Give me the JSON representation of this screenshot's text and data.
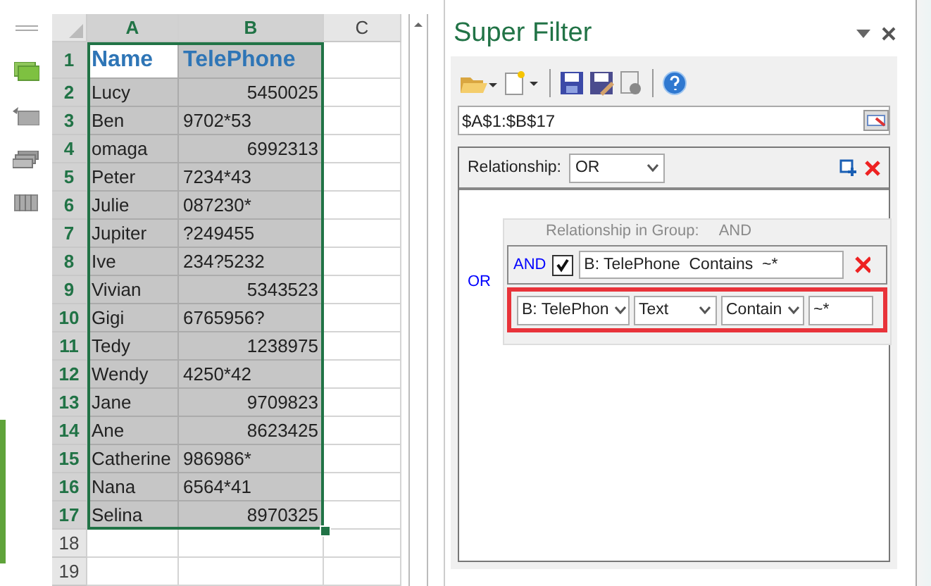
{
  "sheet": {
    "columns": [
      {
        "label": "A",
        "selected": true
      },
      {
        "label": "B",
        "selected": true
      },
      {
        "label": "C",
        "selected": false
      }
    ],
    "rows": [
      {
        "number": "1",
        "selected": true,
        "kind": "header",
        "cells": [
          {
            "text": "Name",
            "active": true
          },
          {
            "text": "TelePhone",
            "active": false
          }
        ]
      },
      {
        "number": "2",
        "selected": true,
        "kind": "data",
        "cells": [
          {
            "text": "Lucy",
            "kind": "text"
          },
          {
            "text": "5450025",
            "kind": "number"
          }
        ]
      },
      {
        "number": "3",
        "selected": true,
        "kind": "data",
        "cells": [
          {
            "text": "Ben",
            "kind": "text"
          },
          {
            "text": "9702*53",
            "kind": "text"
          }
        ]
      },
      {
        "number": "4",
        "selected": true,
        "kind": "data",
        "cells": [
          {
            "text": "omaga",
            "kind": "text"
          },
          {
            "text": "6992313",
            "kind": "number"
          }
        ]
      },
      {
        "number": "5",
        "selected": true,
        "kind": "data",
        "cells": [
          {
            "text": "Peter",
            "kind": "text"
          },
          {
            "text": "7234*43",
            "kind": "text"
          }
        ]
      },
      {
        "number": "6",
        "selected": true,
        "kind": "data",
        "cells": [
          {
            "text": "Julie",
            "kind": "text"
          },
          {
            "text": "087230*",
            "kind": "text"
          }
        ]
      },
      {
        "number": "7",
        "selected": true,
        "kind": "data",
        "cells": [
          {
            "text": "Jupiter",
            "kind": "text"
          },
          {
            "text": "?249455",
            "kind": "text"
          }
        ]
      },
      {
        "number": "8",
        "selected": true,
        "kind": "data",
        "cells": [
          {
            "text": "Ive",
            "kind": "text"
          },
          {
            "text": "234?5232",
            "kind": "text"
          }
        ]
      },
      {
        "number": "9",
        "selected": true,
        "kind": "data",
        "cells": [
          {
            "text": "Vivian",
            "kind": "text"
          },
          {
            "text": "5343523",
            "kind": "number"
          }
        ]
      },
      {
        "number": "10",
        "selected": true,
        "kind": "data",
        "cells": [
          {
            "text": "Gigi",
            "kind": "text"
          },
          {
            "text": "6765956?",
            "kind": "text"
          }
        ]
      },
      {
        "number": "11",
        "selected": true,
        "kind": "data",
        "cells": [
          {
            "text": "Tedy",
            "kind": "text"
          },
          {
            "text": "1238975",
            "kind": "number"
          }
        ]
      },
      {
        "number": "12",
        "selected": true,
        "kind": "data",
        "cells": [
          {
            "text": "Wendy",
            "kind": "text"
          },
          {
            "text": "4250*42",
            "kind": "text"
          }
        ]
      },
      {
        "number": "13",
        "selected": true,
        "kind": "data",
        "cells": [
          {
            "text": "Jane",
            "kind": "text"
          },
          {
            "text": "9709823",
            "kind": "number"
          }
        ]
      },
      {
        "number": "14",
        "selected": true,
        "kind": "data",
        "cells": [
          {
            "text": "Ane",
            "kind": "text"
          },
          {
            "text": "8623425",
            "kind": "number"
          }
        ]
      },
      {
        "number": "15",
        "selected": true,
        "kind": "data",
        "cells": [
          {
            "text": "Catherine",
            "kind": "text"
          },
          {
            "text": "986986*",
            "kind": "text"
          }
        ]
      },
      {
        "number": "16",
        "selected": true,
        "kind": "data",
        "cells": [
          {
            "text": "Nana",
            "kind": "text"
          },
          {
            "text": "6564*41",
            "kind": "text"
          }
        ]
      },
      {
        "number": "17",
        "selected": true,
        "kind": "data",
        "cells": [
          {
            "text": "Selina",
            "kind": "text"
          },
          {
            "text": "8970325",
            "kind": "number"
          }
        ]
      },
      {
        "number": "18",
        "selected": false,
        "kind": "empty",
        "cells": []
      },
      {
        "number": "19",
        "selected": false,
        "kind": "empty",
        "cells": []
      }
    ]
  },
  "panel": {
    "title": "Super Filter",
    "range": "$A$1:$B$17",
    "relationship": {
      "label": "Relationship:",
      "value": "OR"
    },
    "or_label": "OR",
    "group": {
      "caption": "Relationship in Group:",
      "caption_value": "AND",
      "conditions": [
        {
          "connector": "AND",
          "checked": true,
          "text": "B: TelePhone  Contains  ~*"
        }
      ],
      "editor": {
        "column": "B: TelePhon",
        "type": "Text",
        "operator": "Contain",
        "value": "~*"
      }
    }
  }
}
